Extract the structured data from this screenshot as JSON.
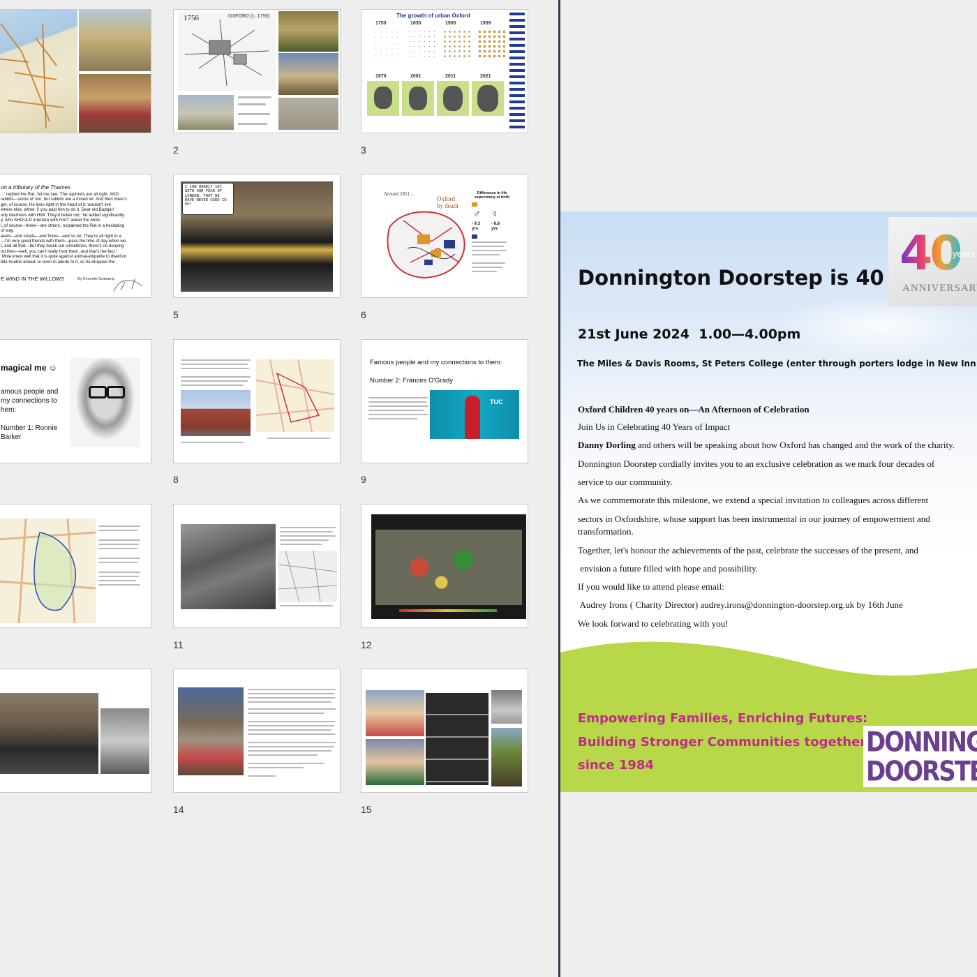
{
  "app": {
    "window": "Presentation slide sorter with document preview"
  },
  "slides": [
    {
      "number": ""
    },
    {
      "number": "2"
    },
    {
      "number": "3"
    },
    {
      "number": ""
    },
    {
      "number": "5"
    },
    {
      "number": "6"
    },
    {
      "number": ""
    },
    {
      "number": "8"
    },
    {
      "number": "9"
    },
    {
      "number": ""
    },
    {
      "number": "11"
    },
    {
      "number": "12"
    },
    {
      "number": ""
    },
    {
      "number": "14"
    },
    {
      "number": "15"
    }
  ],
  "slide_text": {
    "s2_year": "1756",
    "s2_caption": "OXFORD (c. 1756)",
    "s3_title": "The growth of urban Oxford",
    "s3_years": [
      "1750",
      "1830",
      "1900",
      "1939",
      "1970",
      "2001",
      "2011",
      "2021"
    ],
    "s4_heading": "on a tributary of the Thames",
    "s4_body": "...' replied the Rat, 'let me see. The squirrels are all right. AND\nrabbits—some of 'em, but rabbits are a mixed lot. And then there's\nger, of course. He lives right in the heart of it; wouldn't live\nwhere else, either, if you paid him to do it. Dear old Badger!\nody interferes with HIM. They'd better not,' he added significantly.\ny, who SHOULD interfere with him?' asked the Mole.\nl, of course—there—are others,' explained the Rat in a hesitating\nof way.\nasels—and stoats—and foxes—and so on. They're all right in a\n—I'm very good friends with them—pass the time of day when we\nt, and all that—but they break out sometimes, there's no denying\nnd then—well, you can't really trust them, and that's the fact.'\n Mole knew well that it is quite against animal-etiquette to dwell on\nible trouble ahead, or even to allude to it; so he dropped the",
    "s4_footer": "E WIND IN THE WILLOWS",
    "s4_footer_small": "By Kenneth Grahame,",
    "s5_bubble": "I CAN HARDLY SAY, WITH OUR FEAR OF LONDON, THAT WE HAVE NEVER USED CO-OP!",
    "s6_label1": "Around 2011 ...",
    "s6_label2": "Oxford\nby death",
    "s6_label3": "Difference in life\nexpectancy at birth",
    "s6_m": "♂",
    "s6_f": "♀",
    "s6_v1": "- 9.3\nyrs",
    "s6_v2": "- 6.8\nyrs",
    "s7_title": "magical me ☺",
    "s7_body": "amous people and\nmy connections to\nhem:\n\nNumber 1: Ronnie\nBarker",
    "s9_l1": "Famous people and my connections to them:",
    "s9_l2": "Number 2: Frances O'Grady",
    "s9_tuc": "TUC"
  },
  "poster": {
    "title": "Donnington Doorstep is 40",
    "badge_num": "40",
    "badge_years": "years",
    "badge_word": "ANNIVERSARY",
    "date_line": "21st June 2024  1.00—4.00pm",
    "venue": "The Miles & Davis Rooms, St Peters College (enter through porters lodge in New Inn Hall Street)",
    "event_title": "Oxford Children 40 years on—An Afternoon of Celebration",
    "join": "Join Us in Celebrating 40 Years of Impact",
    "speaker_name": "Danny Dorling",
    "speaker_rest": " and others will be speaking about how Oxford has changed and the work of the charity.",
    "invite1": "Donnington Doorstep cordially invites you to an exclusive celebration as we mark four decades of",
    "invite2": "service to our community.",
    "commem1": "As we commemorate this milestone, we extend a special invitation to colleagues across different",
    "commem2": "sectors in Oxfordshire, whose support has been instrumental in our journey of empowerment and",
    "commem3": "transformation.",
    "together1": "Together, let's honour the achievements of the past, celebrate the successes of the present, and",
    "together2": " envision a future filled with hope and possibility.",
    "attend": "If you would like to attend please email:",
    "contact": " Audrey Irons ( Charity Director) audrey.irons@donnington-doorstep.org.uk by 16th June",
    "closing": "We look forward to celebrating with you!",
    "tagline1": "Empowering Families, Enriching Futures:",
    "tagline2": "Building Stronger Communities together",
    "tagline3": "since 1984",
    "logo1": "DONNINGTON",
    "logo2": "DOORSTEP"
  },
  "colors": {
    "tagline": "#c22a8a",
    "green_band": "#b8d84a",
    "logo_purple": "#6b3f8e"
  }
}
